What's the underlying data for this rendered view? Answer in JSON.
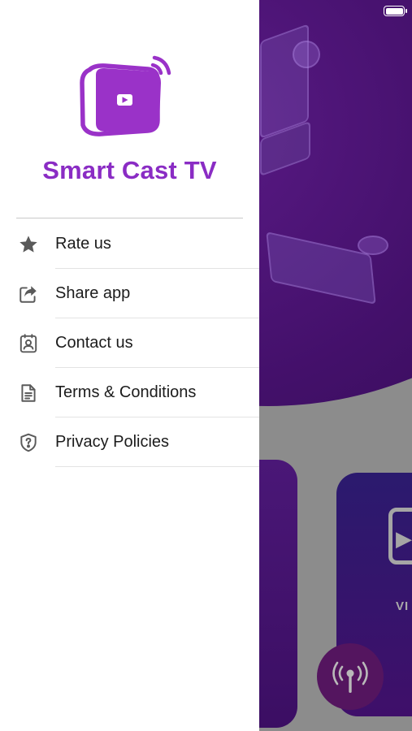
{
  "app": {
    "name": "Smart Cast TV"
  },
  "menu": {
    "items": [
      {
        "label": "Rate us",
        "icon": "star-icon"
      },
      {
        "label": "Share app",
        "icon": "share-icon"
      },
      {
        "label": "Contact us",
        "icon": "contact-card-icon"
      },
      {
        "label": "Terms & Conditions",
        "icon": "document-icon"
      },
      {
        "label": "Privacy Policies",
        "icon": "shield-question-icon"
      }
    ]
  },
  "background": {
    "card_label_partial": "VI",
    "fab_icon": "broadcast-antenna-icon"
  },
  "colors": {
    "brand_purple": "#8a2cc4",
    "logo_purple": "#9a32c8",
    "icon_gray": "#5a5a5a"
  }
}
